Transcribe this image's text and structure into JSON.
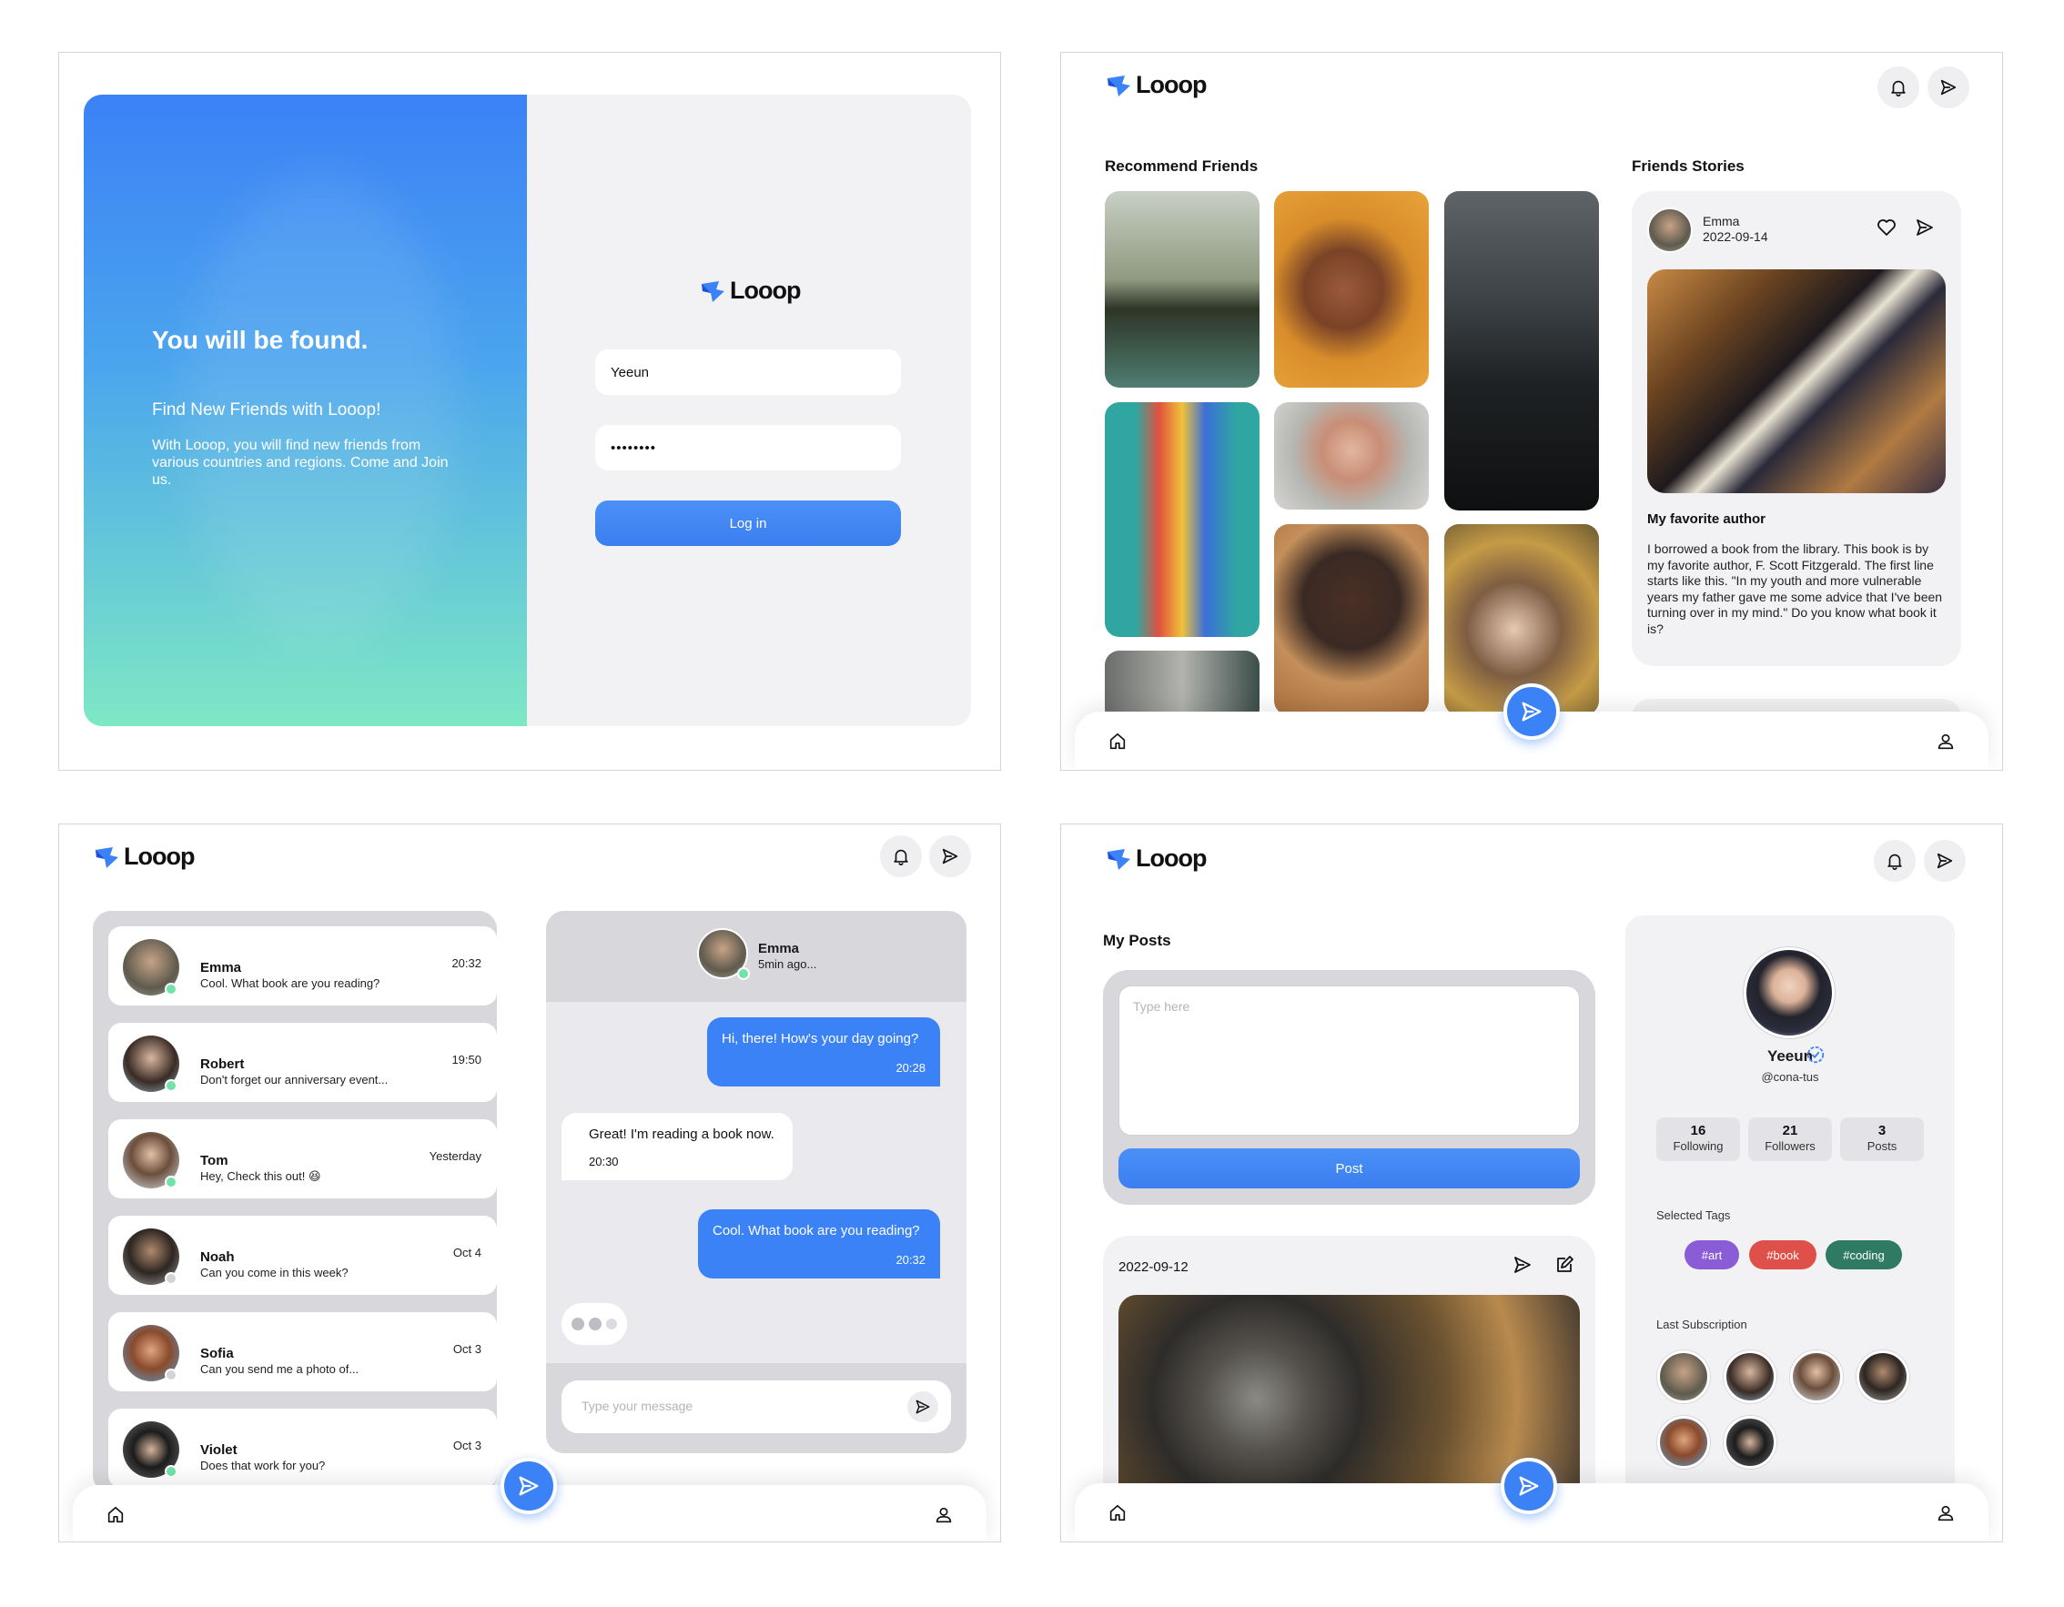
{
  "brand": {
    "name": "Looop",
    "accent": "#3b82f6"
  },
  "login": {
    "headline": "You will be found.",
    "subheadline": "Find New Friends with Looop!",
    "description": "With Looop, you will find new friends from various countries and regions. Come and Join us.",
    "username_value": "Yeeun",
    "password_value": "••••••••",
    "login_label": "Log in"
  },
  "feed": {
    "recommend_title": "Recommend Friends",
    "stories_title": "Friends Stories",
    "story": {
      "author": "Emma",
      "date": "2022-09-14",
      "title": "My favorite author",
      "body": "I borrowed a book from the library. This book is by my favorite author, F. Scott Fitzgerald. The first line starts like this. \"In my youth and more vulnerable years my father gave me some advice that I've been turning over in my mind.\" Do you know what book it is?"
    }
  },
  "chat": {
    "conversations": [
      {
        "name": "Emma",
        "message": "Cool. What book are you reading?",
        "time": "20:32",
        "online": true
      },
      {
        "name": "Robert",
        "message": "Don't forget our anniversary event...",
        "time": "19:50",
        "online": true
      },
      {
        "name": "Tom",
        "message": "Hey, Check this out! 😆",
        "time": "Yesterday",
        "online": true
      },
      {
        "name": "Noah",
        "message": "Can you come in this week?",
        "time": "Oct 4",
        "online": false
      },
      {
        "name": "Sofia",
        "message": "Can you send me a photo of...",
        "time": "Oct 3",
        "online": false
      },
      {
        "name": "Violet",
        "message": "Does that work for you?",
        "time": "Oct 3",
        "online": true
      }
    ],
    "active": {
      "name": "Emma",
      "status": "5min ago..."
    },
    "messages": [
      {
        "from": "me",
        "text": "Hi, there! How's your day going?",
        "time": "20:28"
      },
      {
        "from": "them",
        "text": "Great! I'm reading a book now.",
        "time": "20:30"
      },
      {
        "from": "me",
        "text": "Cool. What book are you reading?",
        "time": "20:32"
      }
    ],
    "input_placeholder": "Type your message"
  },
  "profile": {
    "my_posts_title": "My Posts",
    "post_placeholder": "Type here",
    "post_label": "Post",
    "post_date": "2022-09-12",
    "user": {
      "name": "Yeeun",
      "handle": "@cona-tus"
    },
    "stats": [
      {
        "value": "16",
        "label": "Following"
      },
      {
        "value": "21",
        "label": "Followers"
      },
      {
        "value": "3",
        "label": "Posts"
      }
    ],
    "selected_tags_title": "Selected Tags",
    "tags": [
      {
        "label": "#art",
        "color": "#8a5cd6"
      },
      {
        "label": "#book",
        "color": "#e0504a"
      },
      {
        "label": "#coding",
        "color": "#2f7a62"
      }
    ],
    "last_subscription_title": "Last Subscription"
  }
}
